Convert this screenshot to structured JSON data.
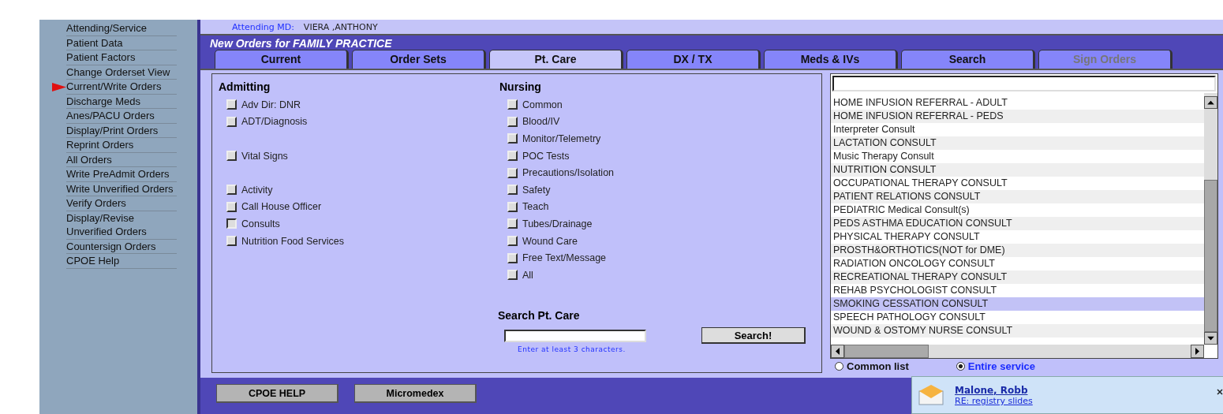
{
  "header": {
    "label": "Attending MD:",
    "value": "VIERA ,ANTHONY"
  },
  "sidebar": {
    "items": [
      {
        "label": "Attending/Service",
        "selected": false
      },
      {
        "label": "Patient Data",
        "selected": false
      },
      {
        "label": "Patient Factors",
        "selected": false
      },
      {
        "label": "Change Orderset View",
        "selected": false
      },
      {
        "label": "Current/Write Orders",
        "selected": true
      },
      {
        "label": "Discharge Meds",
        "selected": false
      },
      {
        "label": "Anes/PACU Orders",
        "selected": false
      },
      {
        "label": "Display/Print Orders",
        "selected": false
      },
      {
        "label": "Reprint Orders",
        "selected": false
      },
      {
        "label": "All Orders",
        "selected": false
      },
      {
        "label": "Write PreAdmit Orders",
        "selected": false
      },
      {
        "label": "Write Unverified Orders",
        "selected": false
      },
      {
        "label": "Verify Orders",
        "selected": false
      },
      {
        "label": "Display/Revise Unverified Orders",
        "selected": false
      },
      {
        "label": "Countersign Orders",
        "selected": false
      },
      {
        "label": "CPOE Help",
        "selected": false
      }
    ]
  },
  "title": "New Orders for FAMILY PRACTICE",
  "tabs": [
    {
      "label": "Current",
      "selected": false,
      "disabled": false
    },
    {
      "label": "Order Sets",
      "selected": false,
      "disabled": false
    },
    {
      "label": "Pt. Care",
      "selected": true,
      "disabled": false
    },
    {
      "label": "DX / TX",
      "selected": false,
      "disabled": false
    },
    {
      "label": "Meds & IVs",
      "selected": false,
      "disabled": false
    },
    {
      "label": "Search",
      "selected": false,
      "disabled": false
    },
    {
      "label": "Sign Orders",
      "selected": false,
      "disabled": true
    }
  ],
  "sections": [
    {
      "heading": "Admitting",
      "groups": [
        [
          {
            "label": "Adv Dir:  DNR",
            "pressed": false
          },
          {
            "label": "ADT/Diagnosis",
            "pressed": false
          }
        ],
        [
          {
            "label": "Vital Signs",
            "pressed": false
          }
        ],
        [
          {
            "label": "Activity",
            "pressed": false
          },
          {
            "label": "Call House Officer",
            "pressed": false
          },
          {
            "label": "Consults",
            "pressed": true
          },
          {
            "label": "Nutrition Food Services",
            "pressed": false
          }
        ]
      ]
    },
    {
      "heading": "Nursing",
      "groups": [
        [
          {
            "label": "Common",
            "pressed": false
          },
          {
            "label": "Blood/IV",
            "pressed": false
          },
          {
            "label": "Monitor/Telemetry",
            "pressed": false
          },
          {
            "label": "POC Tests",
            "pressed": false
          },
          {
            "label": "Precautions/Isolation",
            "pressed": false
          },
          {
            "label": "Safety",
            "pressed": false
          },
          {
            "label": "Teach",
            "pressed": false
          },
          {
            "label": "Tubes/Drainage",
            "pressed": false
          },
          {
            "label": "Wound Care",
            "pressed": false
          },
          {
            "label": "Free Text/Message",
            "pressed": false
          },
          {
            "label": "All",
            "pressed": false
          }
        ]
      ]
    }
  ],
  "search": {
    "heading": "Search Pt. Care",
    "button": "Search!",
    "hint": "Enter at least 3 characters."
  },
  "list": {
    "items": [
      {
        "label": "HOME INFUSION REFERRAL - ADULT",
        "selected": false
      },
      {
        "label": "HOME INFUSION REFERRAL - PEDS",
        "selected": false
      },
      {
        "label": "Interpreter Consult",
        "selected": false
      },
      {
        "label": "LACTATION CONSULT",
        "selected": false
      },
      {
        "label": "Music Therapy Consult",
        "selected": false
      },
      {
        "label": "NUTRITION CONSULT",
        "selected": false
      },
      {
        "label": "OCCUPATIONAL THERAPY CONSULT",
        "selected": false
      },
      {
        "label": "PATIENT RELATIONS CONSULT",
        "selected": false
      },
      {
        "label": "PEDIATRIC Medical Consult(s)",
        "selected": false
      },
      {
        "label": "PEDS ASTHMA EDUCATION CONSULT",
        "selected": false
      },
      {
        "label": "PHYSICAL THERAPY CONSULT",
        "selected": false
      },
      {
        "label": "PROSTH&ORTHOTICS(NOT for DME)",
        "selected": false
      },
      {
        "label": "RADIATION ONCOLOGY CONSULT",
        "selected": false
      },
      {
        "label": "RECREATIONAL THERAPY CONSULT",
        "selected": false
      },
      {
        "label": "REHAB PSYCHOLOGIST CONSULT",
        "selected": false
      },
      {
        "label": "SMOKING CESSATION CONSULT",
        "selected": true
      },
      {
        "label": "SPEECH PATHOLOGY CONSULT",
        "selected": false
      },
      {
        "label": "WOUND & OSTOMY NURSE CONSULT",
        "selected": false
      }
    ],
    "scopes": [
      {
        "label": "Common list",
        "selected": false
      },
      {
        "label": "Entire service",
        "selected": true
      }
    ]
  },
  "footer_buttons": [
    "CPOE HELP",
    "Micromedex"
  ],
  "notification": {
    "sender": "Malone, Robb",
    "subject": "RE: registry slides"
  }
}
